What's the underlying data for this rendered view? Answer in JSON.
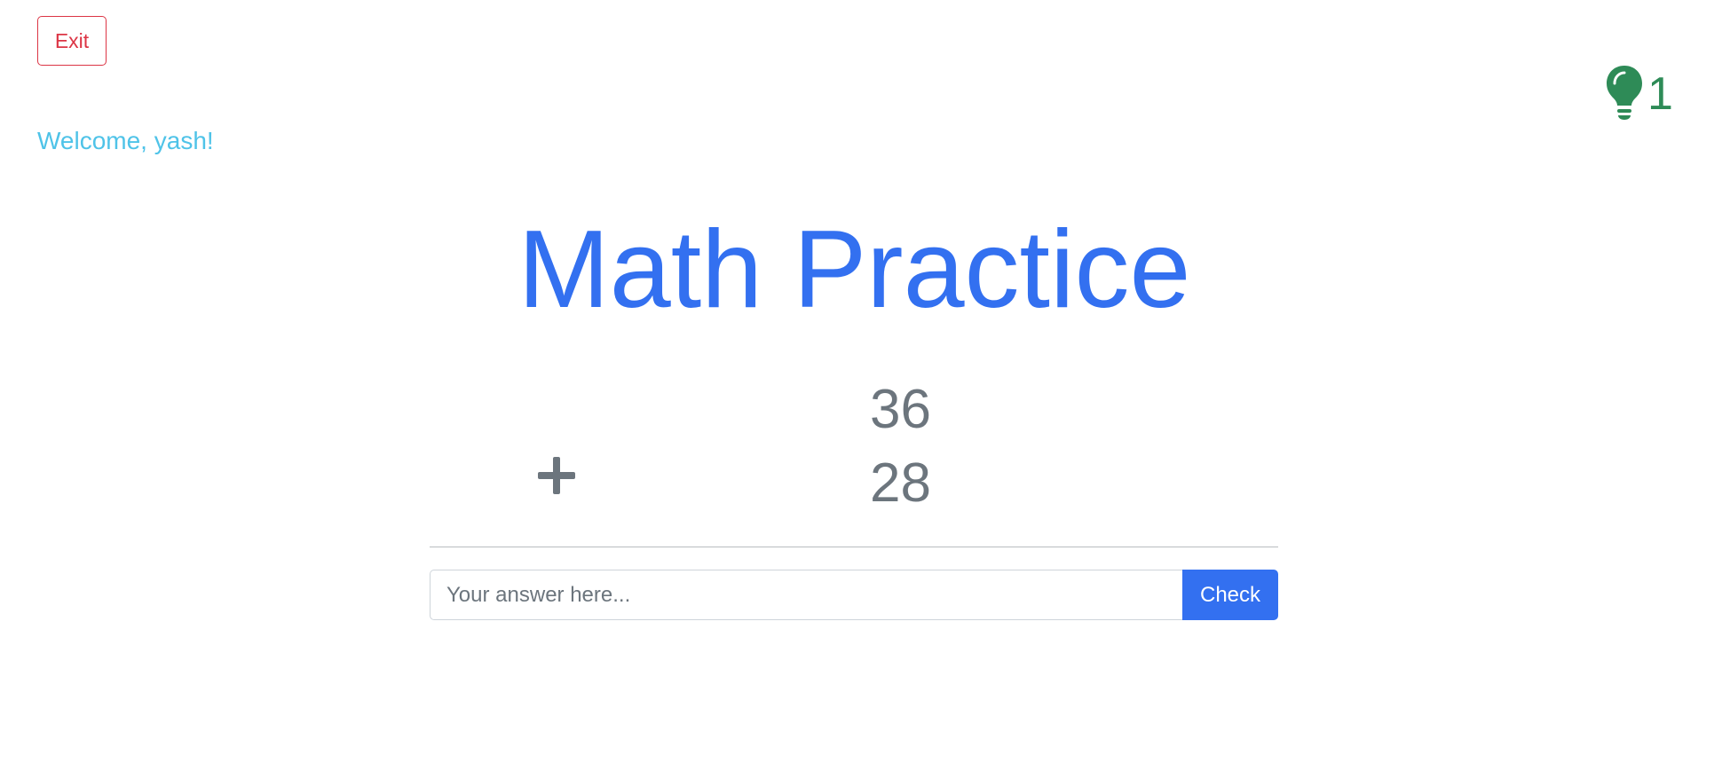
{
  "header": {
    "exit_label": "Exit",
    "welcome_text": "Welcome, yash!",
    "hint": {
      "icon": "lightbulb-icon",
      "count": "1",
      "color": "#2e8b57"
    }
  },
  "main": {
    "title": "Math Practice",
    "problem": {
      "operand_1": "36",
      "operator": "+",
      "operand_2": "28"
    },
    "answer": {
      "value": "",
      "placeholder": "Your answer here...",
      "check_label": "Check"
    }
  },
  "colors": {
    "primary": "#3370f0",
    "danger": "#dc3545",
    "info": "#4fc3e8",
    "muted": "#6c757d",
    "success": "#2e8b57"
  }
}
